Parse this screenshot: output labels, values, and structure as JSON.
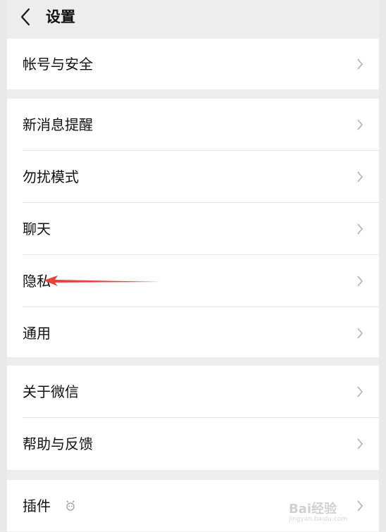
{
  "header": {
    "title": "设置",
    "back_icon": "chevron-left-icon"
  },
  "groups": [
    {
      "items": [
        {
          "label": "帐号与安全"
        }
      ]
    },
    {
      "items": [
        {
          "label": "新消息提醒"
        },
        {
          "label": "勿扰模式"
        },
        {
          "label": "聊天"
        },
        {
          "label": "隐私"
        },
        {
          "label": "通用"
        }
      ]
    },
    {
      "items": [
        {
          "label": "关于微信"
        },
        {
          "label": "帮助与反馈"
        }
      ]
    },
    {
      "items": [
        {
          "label": "插件",
          "icon": "plugin-icon"
        }
      ]
    }
  ],
  "annotation": {
    "color": "#e8403a"
  },
  "watermark": {
    "main": "Bai经验",
    "sub": "jingyan.baidu.com"
  }
}
